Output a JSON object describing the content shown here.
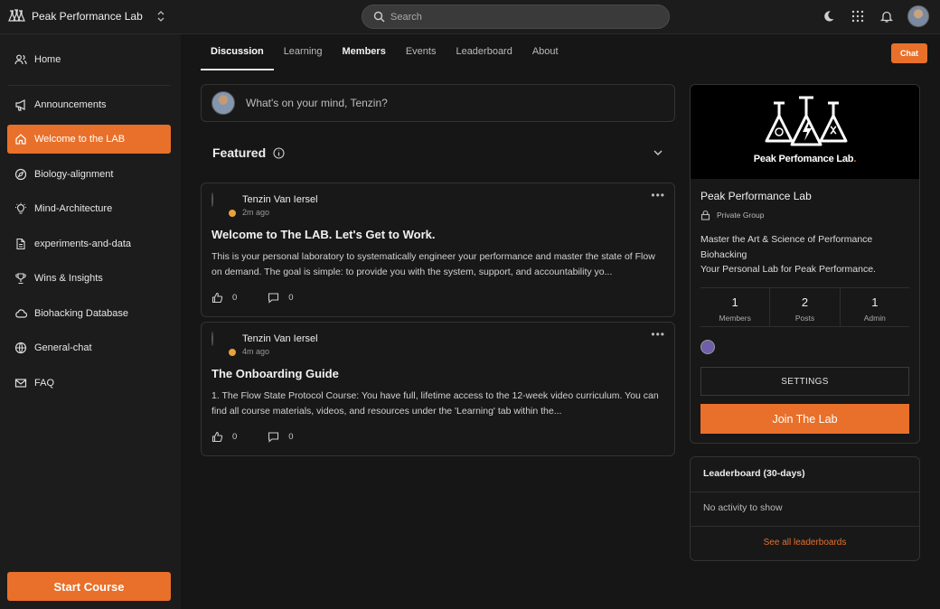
{
  "brand": {
    "name": "Peak Performance Lab"
  },
  "search": {
    "placeholder": "Search"
  },
  "sidebar": {
    "items": [
      {
        "label": "Home",
        "icon": "people-icon"
      },
      {
        "label": "Announcements",
        "icon": "megaphone-icon"
      },
      {
        "label": "Welcome to the LAB",
        "icon": "house-icon",
        "active": true
      },
      {
        "label": "Biology-alignment",
        "icon": "compass-icon"
      },
      {
        "label": "Mind-Architecture",
        "icon": "bulb-icon"
      },
      {
        "label": "experiments-and-data",
        "icon": "document-icon"
      },
      {
        "label": "Wins & Insights",
        "icon": "trophy-icon"
      },
      {
        "label": "Biohacking Database",
        "icon": "cloud-icon"
      },
      {
        "label": "General-chat",
        "icon": "globe-icon"
      },
      {
        "label": "FAQ",
        "icon": "mail-icon"
      }
    ],
    "start_course": "Start Course"
  },
  "tabs": [
    "Discussion",
    "Learning",
    "Members",
    "Events",
    "Leaderboard",
    "About"
  ],
  "chat_label": "Chat",
  "composer": {
    "placeholder": "What's on your mind, Tenzin?"
  },
  "featured": {
    "title": "Featured"
  },
  "posts": [
    {
      "author": "Tenzin Van Iersel",
      "time": "2m ago",
      "title": "Welcome to The LAB. Let's Get to Work.",
      "body": "This is your personal laboratory to systematically engineer your performance and master the state of Flow on demand. The goal is simple: to provide you with the system, support, and accountability yo...",
      "likes": "0",
      "comments": "0"
    },
    {
      "author": "Tenzin Van Iersel",
      "time": "4m ago",
      "title": "The Onboarding Guide",
      "body": "1. The Flow State Protocol Course: You have full, lifetime access to the 12-week video curriculum. You can find all course materials, videos, and resources under the 'Learning' tab within the...",
      "likes": "0",
      "comments": "0"
    }
  ],
  "group": {
    "banner_text": "Peak Perfomance Lab",
    "banner_dot": ".",
    "name": "Peak Performance Lab",
    "privacy": "Private Group",
    "description_line1": "Master the Art & Science of Performance Biohacking",
    "description_line2": "Your Personal Lab for Peak Performance.",
    "stats": [
      {
        "value": "1",
        "label": "Members"
      },
      {
        "value": "2",
        "label": "Posts"
      },
      {
        "value": "1",
        "label": "Admin"
      }
    ],
    "settings_label": "SETTINGS",
    "join_label": "Join The Lab"
  },
  "leaderboard": {
    "title": "Leaderboard (30-days)",
    "empty": "No activity to show",
    "link": "See all leaderboards"
  },
  "colors": {
    "accent": "#e8702a",
    "background": "#161616",
    "panel": "#1c1c1c"
  }
}
